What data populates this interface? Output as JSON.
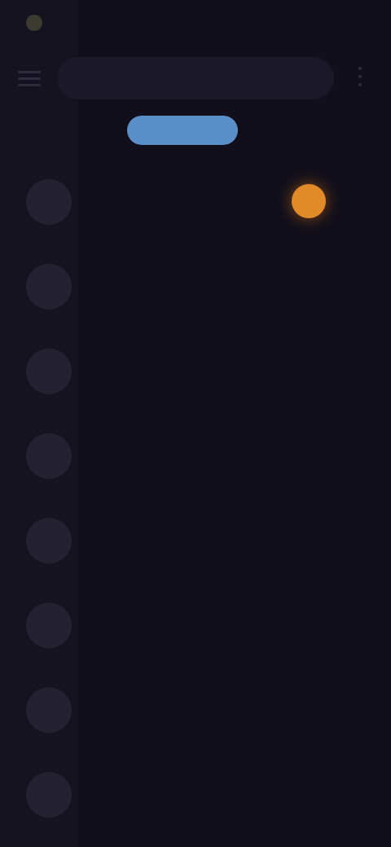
{
  "status_bar": {
    "time": "",
    "indicators": ""
  },
  "search": {
    "placeholder": ""
  },
  "tabs": [
    {
      "label": ""
    },
    {
      "label": ""
    },
    {
      "label": ""
    }
  ],
  "list": [
    {
      "title": "",
      "subtitle": "",
      "has_badge": true
    },
    {
      "title": "",
      "subtitle": ""
    },
    {
      "title": "",
      "subtitle": ""
    },
    {
      "text": ""
    },
    {
      "text": ""
    },
    {
      "text": ""
    },
    {
      "text": ""
    },
    {
      "title": "",
      "subtitle": ""
    }
  ],
  "colors": {
    "background": "#110f1b",
    "accent": "#5a8fc8",
    "badge": "#e08a2a"
  },
  "icons": {
    "menu": "menu-icon",
    "more": "more-vert-icon",
    "status": "status-icon"
  }
}
